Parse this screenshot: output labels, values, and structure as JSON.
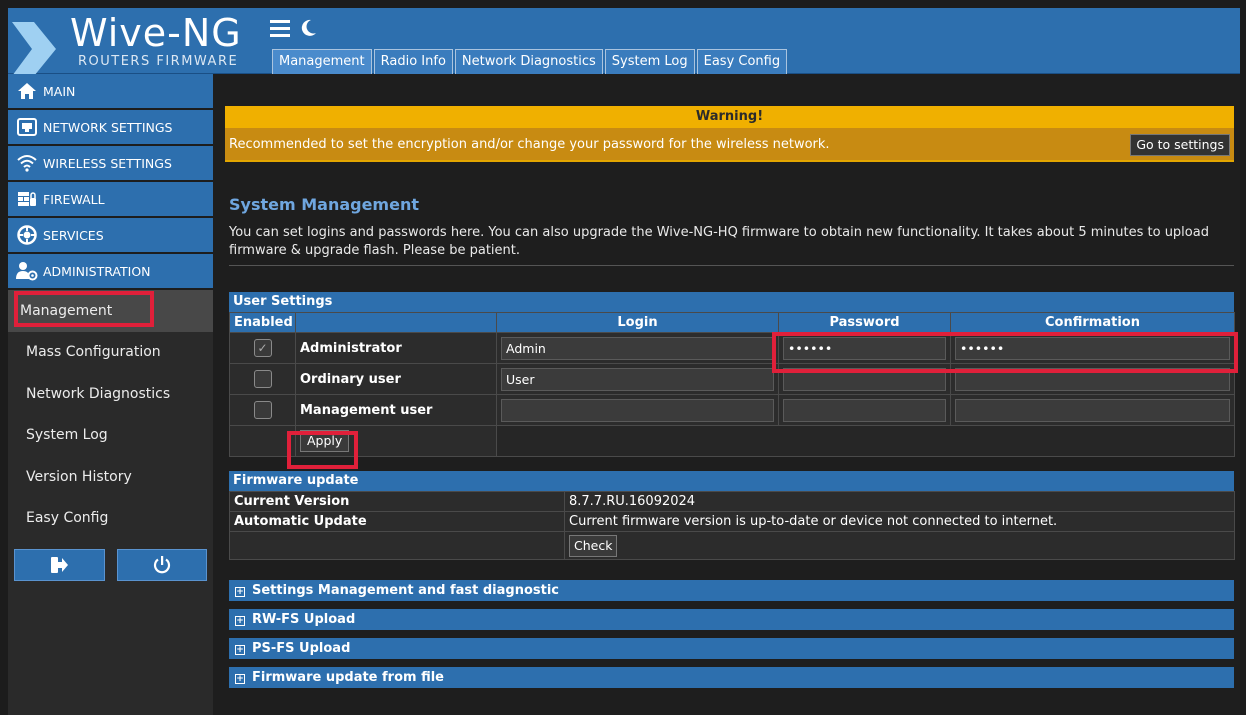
{
  "brand": {
    "title": "Wive-NG",
    "subtitle": "ROUTERS FIRMWARE"
  },
  "header": {
    "icons": [
      "menu-icon",
      "moon-icon"
    ],
    "tabs": [
      {
        "label": "Management",
        "active": true
      },
      {
        "label": "Radio Info"
      },
      {
        "label": "Network Diagnostics"
      },
      {
        "label": "System Log"
      },
      {
        "label": "Easy Config"
      }
    ]
  },
  "sidebar": {
    "menu": [
      {
        "label": "MAIN",
        "icon": "home-icon"
      },
      {
        "label": "NETWORK SETTINGS",
        "icon": "ethernet-port-icon"
      },
      {
        "label": "WIRELESS SETTINGS",
        "icon": "wifi-icon"
      },
      {
        "label": "FIREWALL",
        "icon": "firewall-icon"
      },
      {
        "label": "SERVICES",
        "icon": "services-gear-icon"
      },
      {
        "label": "ADMINISTRATION",
        "icon": "admin-users-icon"
      }
    ],
    "sub": [
      {
        "label": "Management",
        "active": true
      },
      {
        "label": "Mass Configuration"
      },
      {
        "label": "Network Diagnostics"
      },
      {
        "label": "System Log"
      },
      {
        "label": "Version History"
      },
      {
        "label": "Easy Config"
      }
    ],
    "buttons": [
      "logout-icon",
      "power-icon"
    ]
  },
  "warning": {
    "title": "Warning!",
    "message": "Recommended to set the encryption and/or change your password for the wireless network.",
    "button": "Go to settings"
  },
  "system": {
    "title": "System Management",
    "description": "You can set logins and passwords here. You can also upgrade the Wive-NG-HQ firmware to obtain new functionality. It takes about 5 minutes to upload firmware & upgrade flash. Please be patient."
  },
  "user_settings": {
    "title": "User Settings",
    "columns": {
      "enabled": "Enabled",
      "login": "Login",
      "password": "Password",
      "confirmation": "Confirmation"
    },
    "rows": [
      {
        "role": "Administrator",
        "enabled": true,
        "disabled": true,
        "login": "Admin",
        "password": "••••••",
        "confirmation": "••••••"
      },
      {
        "role": "Ordinary user",
        "enabled": false,
        "login": "User",
        "password": "",
        "confirmation": ""
      },
      {
        "role": "Management user",
        "enabled": false,
        "login": "",
        "password": "",
        "confirmation": ""
      }
    ],
    "apply": "Apply"
  },
  "firmware": {
    "title": "Firmware update",
    "current_label": "Current Version",
    "current_value": "8.7.7.RU.16092024",
    "auto_label": "Automatic Update",
    "auto_value": "Current firmware version is up-to-date or device not connected to internet.",
    "check": "Check"
  },
  "sections": [
    "Settings Management and fast diagnostic",
    "RW-FS Upload",
    "PS-FS Upload",
    "Firmware update from file"
  ],
  "colors": {
    "header": "#2d6fae",
    "warning_head": "#f0b000",
    "warning_body": "#c88b12",
    "highlight": "#e0203a",
    "title_blue": "#6fa6df"
  }
}
